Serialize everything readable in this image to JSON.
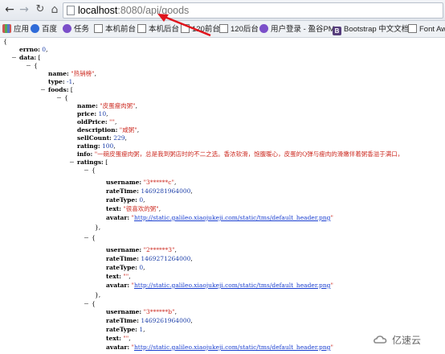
{
  "browser": {
    "back_icon": "arrow-left-icon",
    "forward_icon": "arrow-right-icon",
    "reload_icon": "reload-icon",
    "home_icon": "home-icon",
    "url_host": "localhost",
    "url_rest": ":8080/api/goods"
  },
  "bookmarks": [
    {
      "label": "应用"
    },
    {
      "label": "百度"
    },
    {
      "label": "任务"
    },
    {
      "label": "本机前台"
    },
    {
      "label": "本机后台"
    },
    {
      "label": "120前台"
    },
    {
      "label": "120后台"
    },
    {
      "label": "用户登录 - 盈谷PM"
    },
    {
      "label": "Bootstrap 中文文档"
    },
    {
      "label": "Font Awe"
    }
  ],
  "json": {
    "open_brace": "{",
    "errno_key": "errno:",
    "errno_val": "0",
    "data_key": "data:",
    "bracket_open": "[",
    "brace_open": "{",
    "name_key": "name:",
    "name_val": "\"热销榜\"",
    "type_key": "type:",
    "type_val": "-1",
    "foods_key": "foods:",
    "food": {
      "name_val": "\"皮蛋瘦肉粥\"",
      "price_key": "price:",
      "price_val": "10",
      "oldprice_key": "oldPrice:",
      "oldprice_val": "\"\"",
      "desc_key": "description:",
      "desc_val": "\"咸粥\"",
      "sell_key": "sellCount:",
      "sell_val": "229",
      "rating_key": "rating:",
      "rating_val": "100",
      "info_key": "info:",
      "info_val": "\"一碗皮蛋瘦肉粥，总是我到粥店时的不二之选。香浓软滑，饱腹暖心，皮蛋的Q弹与瘦肉的滑嫩伴着粥香溢于满口，",
      "ratings_key": "ratings:"
    },
    "ratings": [
      {
        "username": "\"3******c\"",
        "rateTime": "1469281964000",
        "rateType": "0",
        "text": "\"很喜欢的粥\"",
        "avatar": "http://static.galileo.xiaojukeji.com/static/tms/default_header.png"
      },
      {
        "username": "\"2******3\"",
        "rateTime": "1469271264000",
        "rateType": "0",
        "text": "\"\"",
        "avatar": "http://static.galileo.xiaojukeji.com/static/tms/default_header.png"
      },
      {
        "username": "\"3******b\"",
        "rateTime": "1469261964000",
        "rateType": "1",
        "text": "\"\"",
        "avatar": "http://static.galileo.xiaojukeji.com/static/tms/default_header.png"
      }
    ],
    "labels": {
      "username": "username:",
      "rateTime": "rateTime:",
      "rateType": "rateType:",
      "text": "text:",
      "avatar": "avatar:"
    },
    "close_item": "},",
    "comma": ",",
    "quote": "\"",
    "toggle": "−"
  },
  "watermark": "亿速云"
}
